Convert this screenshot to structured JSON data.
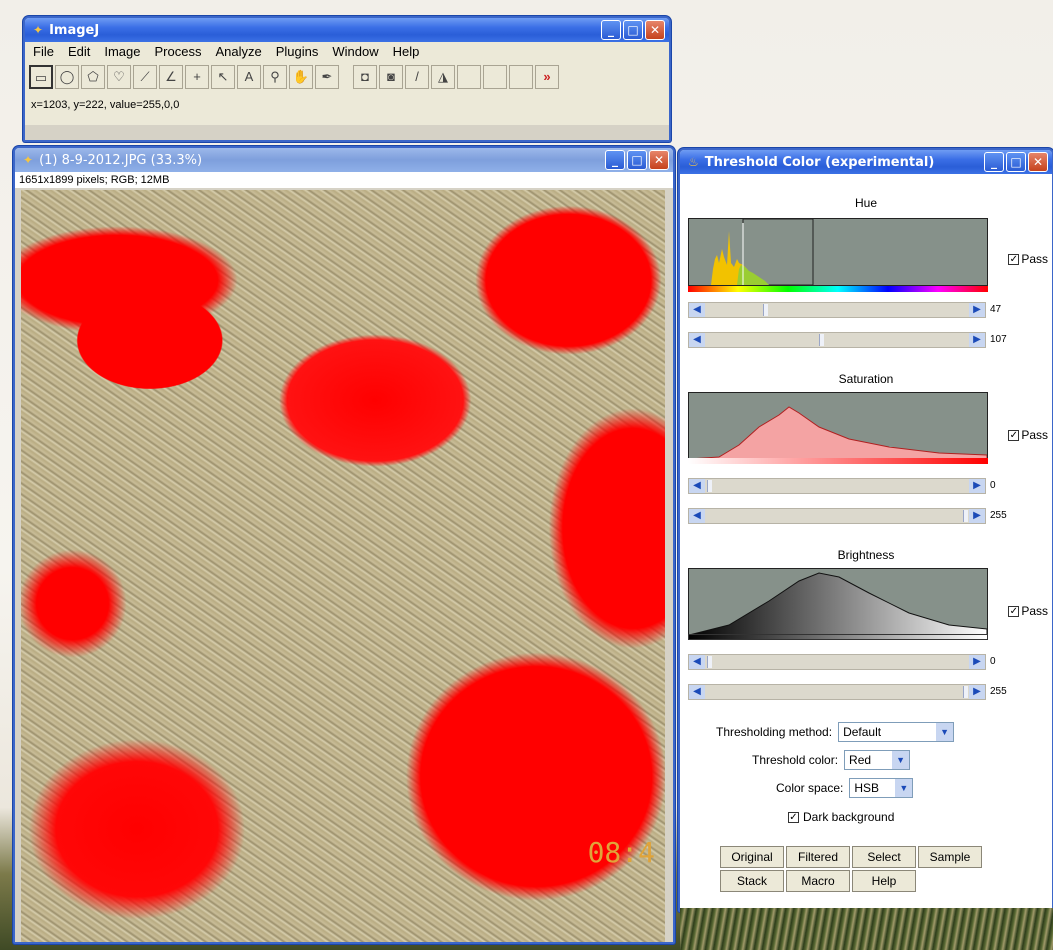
{
  "imagej": {
    "title": "ImageJ",
    "menu": [
      "File",
      "Edit",
      "Image",
      "Process",
      "Analyze",
      "Plugins",
      "Window",
      "Help"
    ],
    "status": "x=1203, y=222, value=255,0,0"
  },
  "image_window": {
    "title": "(1) 8-9-2012.JPG (33.3%)",
    "info": "1651x1899 pixels; RGB; 12MB"
  },
  "threshold": {
    "title": "Threshold Color (experimental)",
    "hue": {
      "label": "Hue",
      "pass": "Pass",
      "min": "47",
      "max": "107",
      "min_frac": 0.18,
      "max_frac": 0.42
    },
    "saturation": {
      "label": "Saturation",
      "pass": "Pass",
      "min": "0",
      "max": "255",
      "min_frac": 0.0,
      "max_frac": 1.0
    },
    "brightness": {
      "label": "Brightness",
      "pass": "Pass",
      "min": "0",
      "max": "255",
      "min_frac": 0.0,
      "max_frac": 1.0
    },
    "method_label": "Thresholding method:",
    "method_value": "Default",
    "color_label": "Threshold color:",
    "color_value": "Red",
    "space_label": "Color space:",
    "space_value": "HSB",
    "dark_bg": "Dark background",
    "buttons": [
      "Original",
      "Filtered",
      "Select",
      "Sample",
      "Stack",
      "Macro",
      "Help"
    ]
  },
  "overlay_text": "08:4"
}
